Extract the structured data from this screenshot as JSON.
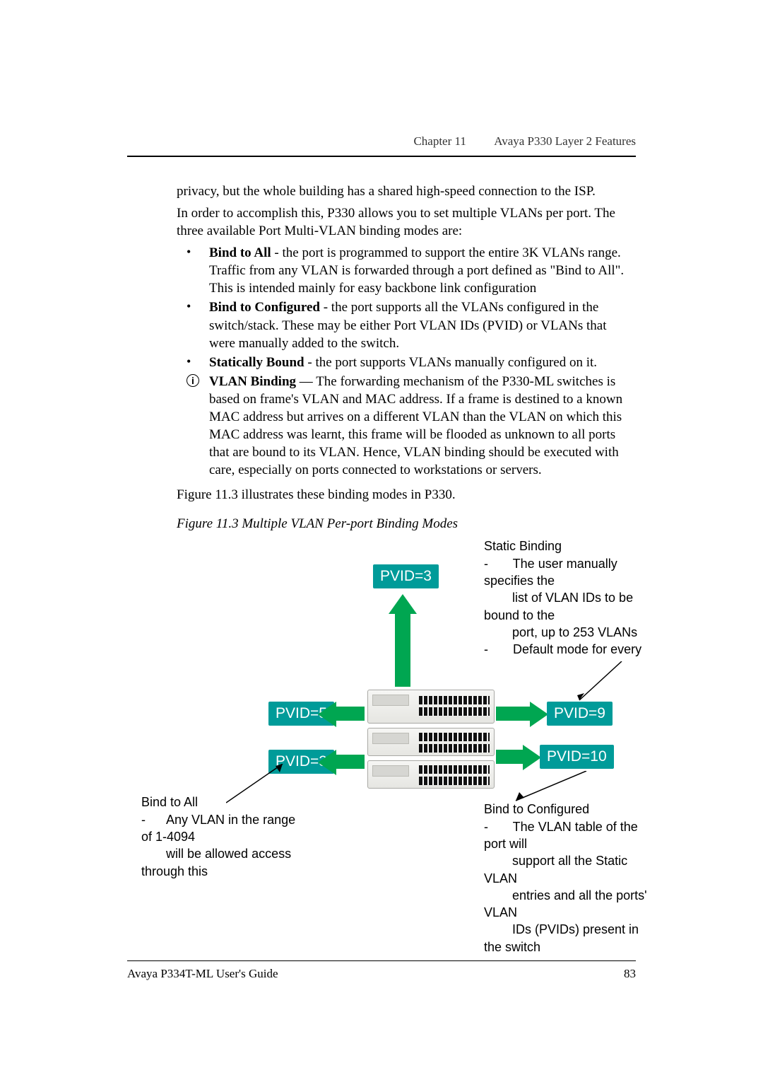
{
  "header": {
    "chapter": "Chapter 11",
    "title": "Avaya P330 Layer 2 Features"
  },
  "body": {
    "p1": "privacy, but the whole building has a shared high-speed connection to the ISP.",
    "p2": "In order to accomplish this, P330 allows you to set multiple VLANs per port. The three available Port Multi-VLAN binding modes are:"
  },
  "bullets": [
    {
      "marker": "•",
      "bold": "Bind to All",
      "tail": " - the port is programmed to support the entire 3K VLANs range. Traffic from any VLAN is forwarded through a port defined as \"Bind to All\". This is intended mainly for easy backbone link configuration"
    },
    {
      "marker": "•",
      "bold": "Bind to Configured",
      "tail": " - the port supports all the VLANs configured in the switch/stack. These may be either Port VLAN IDs (PVID) or VLANs that were manually added to the switch."
    },
    {
      "marker": "•",
      "bold": "Statically Bound",
      "tail": " - the port supports VLANs manually configured on it."
    },
    {
      "marker": "i",
      "bold": "VLAN Binding",
      "tail": " — The forwarding mechanism of the P330-ML switches is based on frame's VLAN and MAC address. If a frame is destined to a known MAC address but arrives on a different VLAN than the VLAN on which this MAC address was learnt, this frame will be flooded as unknown to all ports that are bound to its VLAN. Hence, VLAN binding should be executed with care, especially on ports connected to workstations or servers."
    }
  ],
  "after_list": "Figure 11.3 illustrates these binding modes in P330.",
  "fig_caption": "Figure 11.3    Multiple VLAN Per-port Binding Modes",
  "figure": {
    "pvid_top": "PVID=3",
    "pvid_left_upper": "PVID=5",
    "pvid_left_lower": "PVID=3",
    "pvid_right_upper": "PVID=9",
    "pvid_right_lower": "PVID=10",
    "static_binding": "Static Binding\n-       The user manually\nspecifies the\n        list of VLAN IDs to be\nbound to the\n        port, up to 253 VLANs\n-       Default mode for every",
    "bind_all": "Bind to All\n-      Any VLAN in the range\nof 1-4094\n       will be allowed access\nthrough this",
    "bind_configured": "Bind to Configured\n-       The VLAN table of the\nport will\n        support all the Static\nVLAN\n        entries and all the ports'\nVLAN\n        IDs (PVIDs) present in\nthe switch"
  },
  "footer": {
    "left": "Avaya P334T-ML User's Guide",
    "right": "83"
  }
}
